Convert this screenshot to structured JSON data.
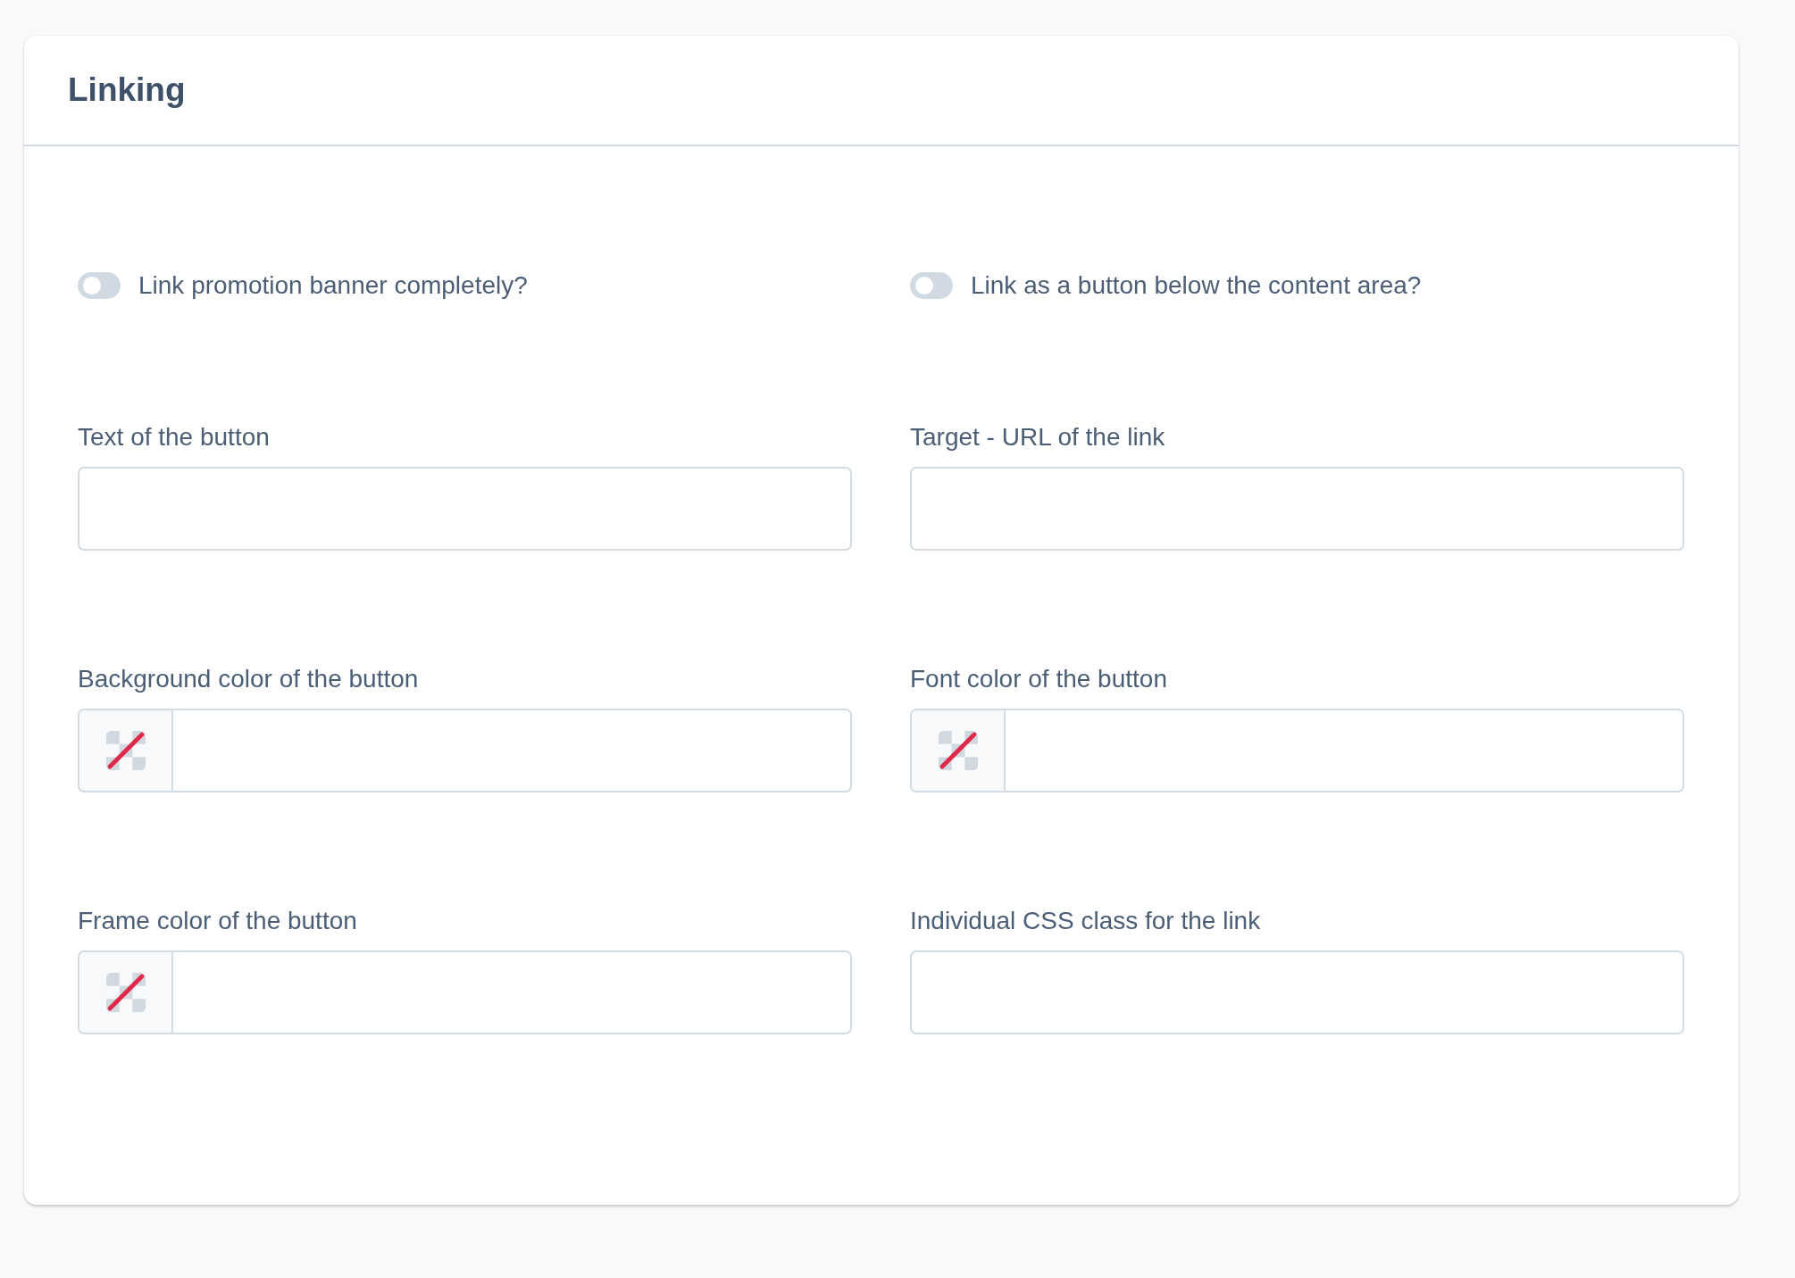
{
  "panel": {
    "title": "Linking"
  },
  "toggles": [
    {
      "label": "Link promotion banner completely?",
      "on": false
    },
    {
      "label": "Link as a button below the content area?",
      "on": false
    }
  ],
  "fields": [
    {
      "kind": "text",
      "label": "Text of the button"
    },
    {
      "kind": "text",
      "label": "Target - URL of the link"
    },
    {
      "kind": "color",
      "label": "Background color of the button"
    },
    {
      "kind": "color",
      "label": "Font color of the button"
    },
    {
      "kind": "color",
      "label": "Frame color of the button"
    },
    {
      "kind": "text",
      "label": "Individual CSS class for the link"
    }
  ]
}
